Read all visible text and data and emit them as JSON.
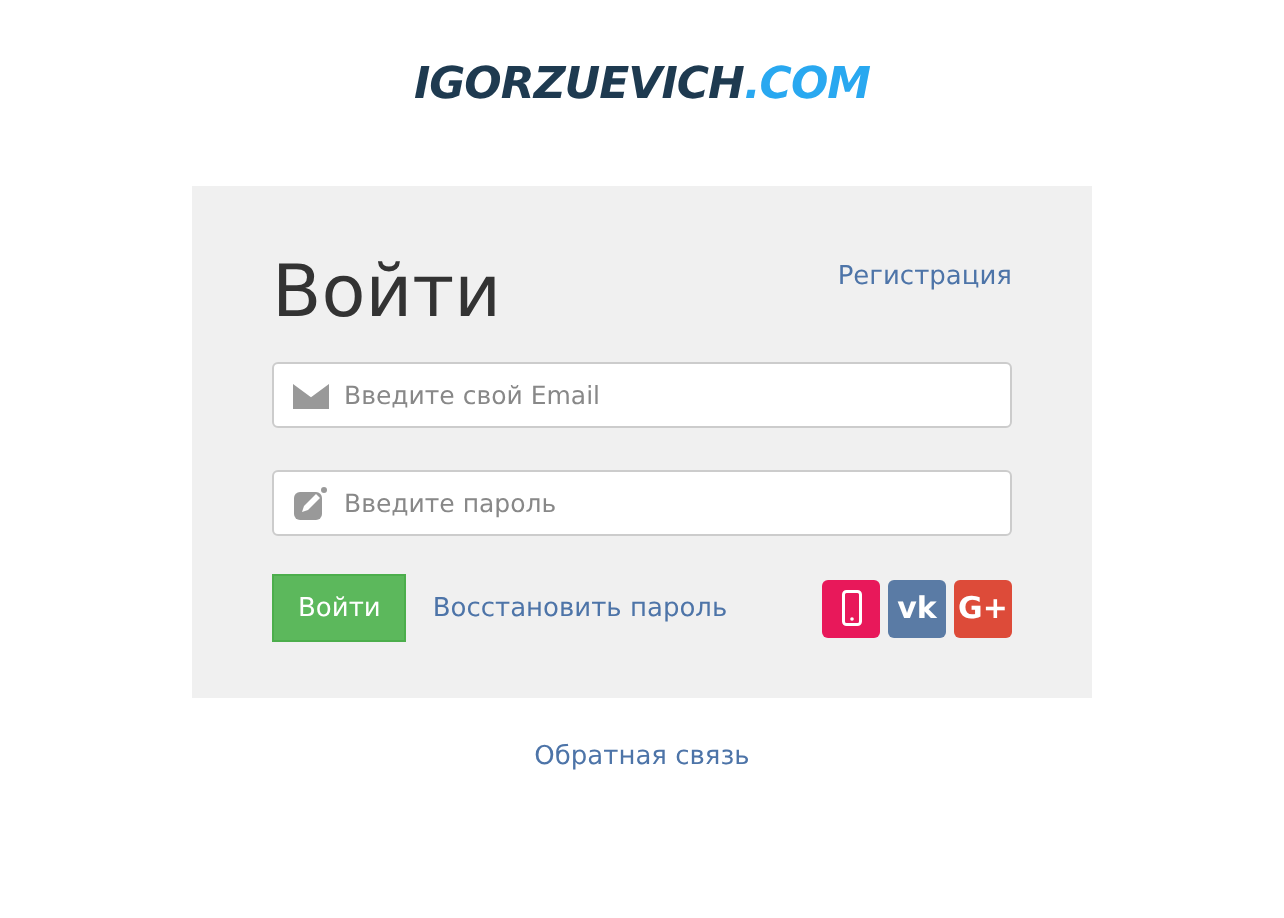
{
  "logo": {
    "name": "IGORZUEVICH",
    "domain": ".COM"
  },
  "form": {
    "title": "Войти",
    "register_link": "Регистрация",
    "fields": [
      {
        "kind": "email",
        "placeholder": "Введите свой Email"
      },
      {
        "kind": "password",
        "placeholder": "Введите пароль"
      }
    ],
    "submit": "Войти",
    "restore_link": "Восстановить пароль",
    "social": [
      {
        "kind": "phone"
      },
      {
        "kind": "vk",
        "label": "vk"
      },
      {
        "kind": "google",
        "label": "G+"
      }
    ]
  },
  "feedback_link": "Обратная связь"
}
